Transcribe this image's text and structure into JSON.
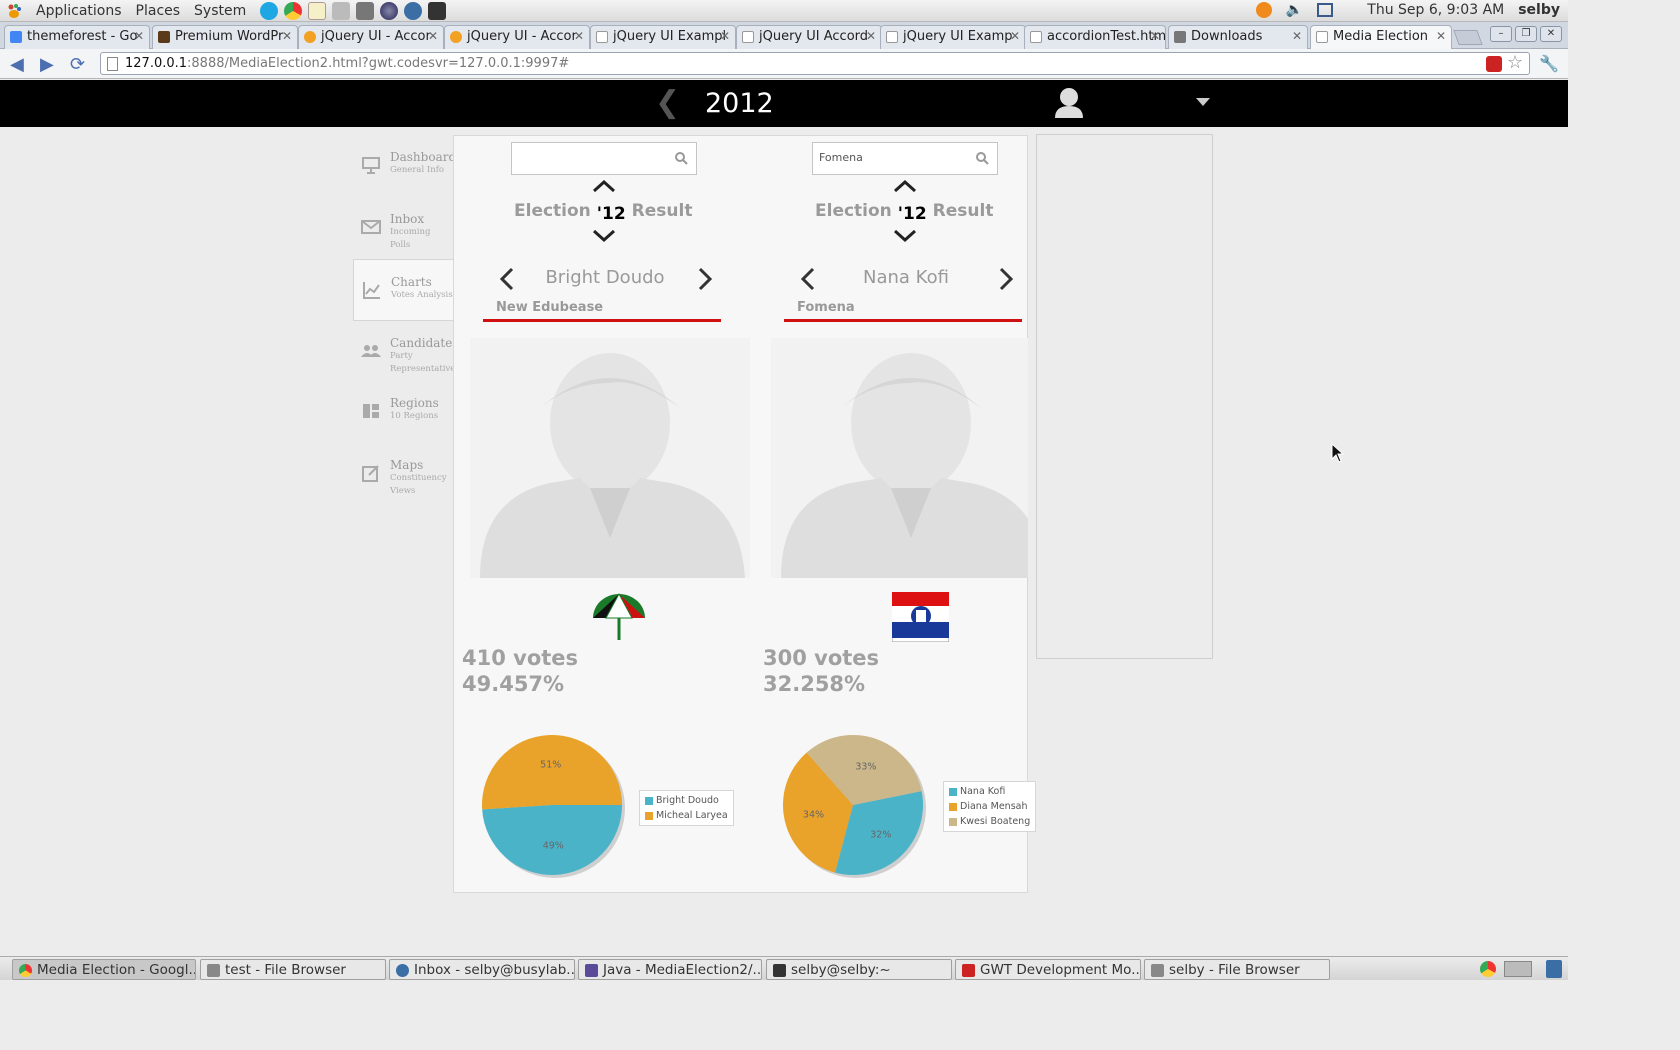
{
  "system_bar": {
    "menus": [
      "Applications",
      "Places",
      "System"
    ],
    "datetime": "Thu Sep  6,  9:03 AM",
    "user": "selby"
  },
  "browser": {
    "tabs": [
      {
        "title": "themeforest - Go",
        "favicon_color": "#4285f4"
      },
      {
        "title": "Premium WordPr",
        "favicon_color": "#5a3a1a"
      },
      {
        "title": "jQuery UI - Accor",
        "favicon_color": "#f3a122"
      },
      {
        "title": "jQuery UI - Accor",
        "favicon_color": "#f3a122"
      },
      {
        "title": "jQuery UI Exampl",
        "favicon_color": "#cccccc"
      },
      {
        "title": "jQuery UI Accord",
        "favicon_color": "#cccccc"
      },
      {
        "title": "jQuery UI Examp",
        "favicon_color": "#cccccc"
      },
      {
        "title": "accordionTest.htm",
        "favicon_color": "#cccccc"
      },
      {
        "title": "Downloads",
        "favicon_color": "#777777"
      },
      {
        "title": "Media Election",
        "favicon_color": "#cccccc"
      }
    ],
    "url_host": "127.0.0.1",
    "url_rest": ":8888/MediaElection2.html?gwt.codesvr=127.0.0.1:9997#"
  },
  "app": {
    "year": "2012",
    "sidebar": [
      {
        "label": "Dashboard",
        "sub": "General Info",
        "icon": "presentation-icon"
      },
      {
        "label": "Inbox",
        "sub": "Incoming Polls",
        "icon": "mail-icon"
      },
      {
        "label": "Charts",
        "sub": "Votes Analysis",
        "icon": "chart-icon"
      },
      {
        "label": "Candidates",
        "sub": "Party Representatives",
        "icon": "people-icon"
      },
      {
        "label": "Regions",
        "sub": "10 Regions",
        "icon": "regions-icon"
      },
      {
        "label": "Maps",
        "sub": "Constituency Views",
        "icon": "map-edit-icon"
      }
    ],
    "columns": [
      {
        "search_value": "",
        "election_left": "Election",
        "election_year": "'12",
        "election_right": "Result",
        "candidate": "Bright Doudo",
        "region": "New Edubease",
        "votes": "410  votes",
        "percent": "49.457%",
        "party_logo": "umbrella-logo",
        "pie_labels": [
          "51%",
          "49%"
        ],
        "legend": [
          "Bright Doudo",
          "Micheal Laryea"
        ]
      },
      {
        "search_value": "Fomena",
        "election_left": "Election",
        "election_year": "'12",
        "election_right": "Result",
        "candidate": "Nana Kofi",
        "region": "Fomena",
        "votes": "300  votes",
        "percent": "32.258%",
        "party_logo": "new-patriotic-party-logo",
        "pie_labels": [
          "33%",
          "34%",
          "32%"
        ],
        "legend": [
          "Nana Kofi",
          "Diana Mensah",
          "Kwesi Boateng"
        ]
      }
    ]
  },
  "chart_data": [
    {
      "type": "pie",
      "series": [
        {
          "name": "Bright Doudo",
          "value": 49,
          "color": "#4bb3c8"
        },
        {
          "name": "Micheal Laryea",
          "value": 51,
          "color": "#e9a22a"
        }
      ]
    },
    {
      "type": "pie",
      "series": [
        {
          "name": "Nana Kofi",
          "value": 32,
          "color": "#4bb3c8"
        },
        {
          "name": "Diana Mensah",
          "value": 34,
          "color": "#e9a22a"
        },
        {
          "name": "Kwesi Boateng",
          "value": 33,
          "color": "#cbb78a"
        }
      ]
    }
  ],
  "taskbar": [
    {
      "title": "Media Election - Googl...",
      "color": "#e33"
    },
    {
      "title": "test - File Browser",
      "color": "#888"
    },
    {
      "title": "Inbox - selby@busylab...",
      "color": "#3a6ea5"
    },
    {
      "title": "Java - MediaElection2/...",
      "color": "#5a4a9a"
    },
    {
      "title": "selby@selby:~",
      "color": "#333"
    },
    {
      "title": "GWT Development Mo...",
      "color": "#c22"
    },
    {
      "title": "selby - File Browser",
      "color": "#888"
    }
  ]
}
